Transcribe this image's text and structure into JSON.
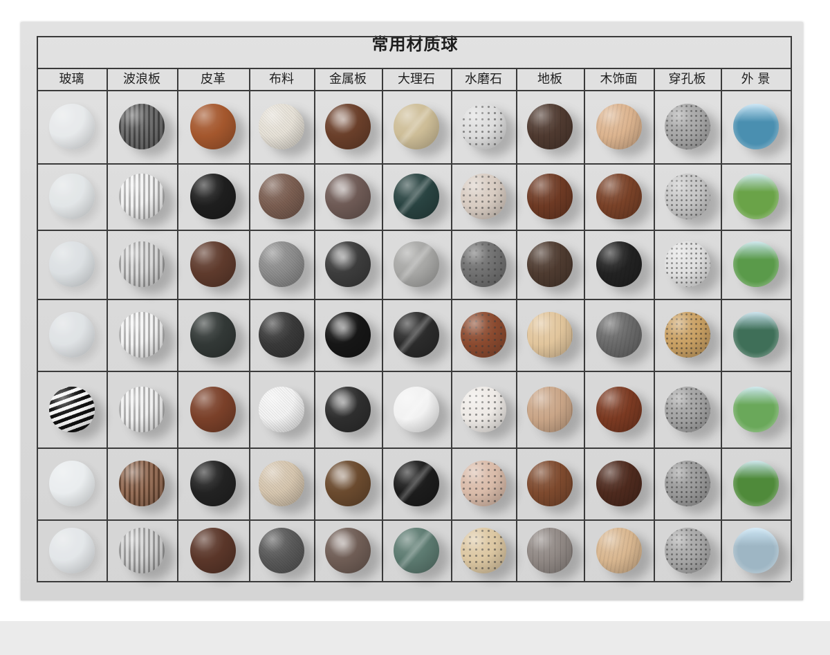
{
  "title": "常用材质球",
  "columns": [
    {
      "key": "glass",
      "label": "玻璃"
    },
    {
      "key": "wave",
      "label": "波浪板"
    },
    {
      "key": "leather",
      "label": "皮革"
    },
    {
      "key": "fabric",
      "label": "布料"
    },
    {
      "key": "metal",
      "label": "金属板"
    },
    {
      "key": "marble",
      "label": "大理石"
    },
    {
      "key": "terrazzo",
      "label": "水磨石"
    },
    {
      "key": "floor",
      "label": "地板"
    },
    {
      "key": "veneer",
      "label": "木饰面"
    },
    {
      "key": "perforated",
      "label": "穿孔板"
    },
    {
      "key": "scenery",
      "label": "外 景"
    }
  ],
  "row_count": 7,
  "material_colors": {
    "glass": [
      "#e9ecee",
      "#e4e8ea",
      "#dde2e5",
      "#e1e5e8",
      "#1a1a1a",
      "#eef2f4",
      "#e6eaed"
    ],
    "wave": [
      "#5e5e5e",
      "#f0f0f0",
      "#d6d6d6",
      "#f2f2f2",
      "#efefef",
      "#8a5f45",
      "#cfcfcf"
    ],
    "leather": [
      "#a4572d",
      "#1e1e1e",
      "#5e3a2c",
      "#323836",
      "#7a4029",
      "#222222",
      "#5a3629"
    ],
    "fabric": [
      "#e7e2d8",
      "#7c5f52",
      "#8d8d8d",
      "#3a3a3a",
      "#f4f4f4",
      "#d7c7b0",
      "#5a5a5a"
    ],
    "metal": [
      "#6a3f2a",
      "#6e5a55",
      "#3c3c3c",
      "#161616",
      "#2e2e2e",
      "#6a4a2e",
      "#6f5d55"
    ],
    "marble": [
      "#cdbd97",
      "#294341",
      "#a7a7a5",
      "#2b2b2b",
      "#f2f2f2",
      "#1c1c1c",
      "#5c7a70"
    ],
    "terrazzo": [
      "#dddddd",
      "#d8ccc2",
      "#707070",
      "#8b4a2f",
      "#eeeae6",
      "#d9bba9",
      "#dcc7a2"
    ],
    "floor": [
      "#4f3a30",
      "#6e3a24",
      "#4e3b30",
      "#e1c59c",
      "#c9a587",
      "#7e4a2e",
      "#908884"
    ],
    "veneer": [
      "#dcb48f",
      "#7a4228",
      "#222222",
      "#6a6a6a",
      "#7c3a22",
      "#4e2a1e",
      "#d9b790"
    ],
    "perforated": [
      "#a7a7a7",
      "#c6c6c6",
      "#e0e0e0",
      "#c9a063",
      "#a3a3a3",
      "#9a9a9a",
      "#a8a8a8"
    ],
    "scenery": [
      "#4a8fb0",
      "#6aa348",
      "#5a9a4a",
      "#3f6f58",
      "#6aa85a",
      "#4f8a3a",
      "#9eb6c4"
    ]
  }
}
